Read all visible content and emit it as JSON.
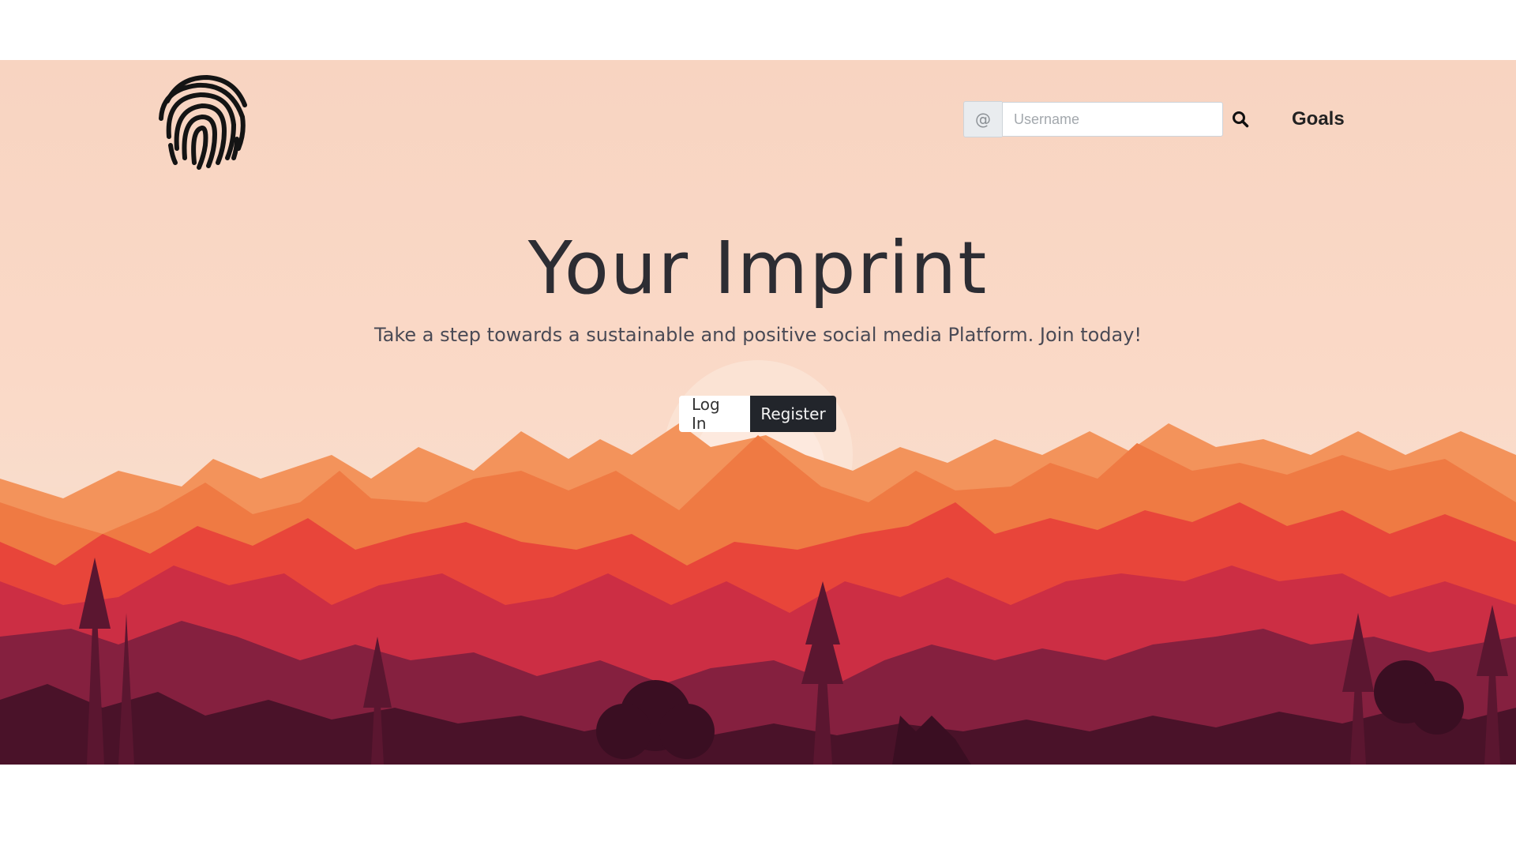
{
  "header": {
    "search": {
      "addon": "@",
      "placeholder": "Username",
      "value": ""
    },
    "nav": {
      "goals_label": "Goals"
    }
  },
  "hero": {
    "title": "Your Imprint",
    "subtitle": "Take a step towards a sustainable and positive social media Platform. Join today!",
    "buttons": {
      "login_label": "Log In",
      "register_label": "Register"
    }
  },
  "colors": {
    "sky": "#f8d4c1",
    "mountain_far": "#f07a45",
    "mountain_mid": "#e8433a",
    "hills": "#c92d45",
    "forest": "#7d1a38",
    "silhouettes": "#3d0f24",
    "button_dark": "#22252b"
  },
  "icons": {
    "logo": "fingerprint-icon",
    "search": "search-icon"
  }
}
